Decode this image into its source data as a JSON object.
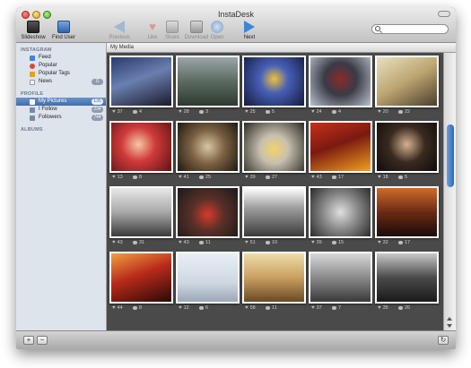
{
  "window": {
    "title": "InstaDesk"
  },
  "toolbar": {
    "slideshow": "Slideshow",
    "find_user": "Find User",
    "previous": "Previous",
    "like": "Like",
    "share": "Share",
    "download": "Download",
    "open": "Open",
    "next": "Next",
    "search_placeholder": ""
  },
  "sidebar": {
    "instagram_header": "INSTAGRAM",
    "profile_header": "PROFILE",
    "albums_header": "ALBUMS",
    "instagram_items": [
      {
        "label": "Feed",
        "badge": ""
      },
      {
        "label": "Popular",
        "badge": ""
      },
      {
        "label": "Popular Tags",
        "badge": ""
      },
      {
        "label": "News",
        "badge": "0"
      }
    ],
    "profile_items": [
      {
        "label": "My Pictures",
        "badge": "135"
      },
      {
        "label": "I Follow",
        "badge": "234"
      },
      {
        "label": "Followers",
        "badge": "744"
      }
    ]
  },
  "main": {
    "header": "My Media",
    "photos": [
      {
        "likes": "37",
        "comments": "4"
      },
      {
        "likes": "28",
        "comments": "3"
      },
      {
        "likes": "25",
        "comments": "5"
      },
      {
        "likes": "24",
        "comments": "4"
      },
      {
        "likes": "20",
        "comments": "22"
      },
      {
        "likes": "13",
        "comments": "8"
      },
      {
        "likes": "41",
        "comments": "25"
      },
      {
        "likes": "39",
        "comments": "27"
      },
      {
        "likes": "43",
        "comments": "17"
      },
      {
        "likes": "18",
        "comments": "5"
      },
      {
        "likes": "43",
        "comments": "31"
      },
      {
        "likes": "43",
        "comments": "11"
      },
      {
        "likes": "51",
        "comments": "10"
      },
      {
        "likes": "39",
        "comments": "15"
      },
      {
        "likes": "32",
        "comments": "17"
      },
      {
        "likes": "44",
        "comments": "8"
      },
      {
        "likes": "12",
        "comments": "6"
      },
      {
        "likes": "58",
        "comments": "11"
      },
      {
        "likes": "37",
        "comments": "7"
      },
      {
        "likes": "35",
        "comments": "26"
      }
    ]
  },
  "bottombar": {
    "add": "+",
    "remove": "−",
    "refresh": "↻"
  }
}
